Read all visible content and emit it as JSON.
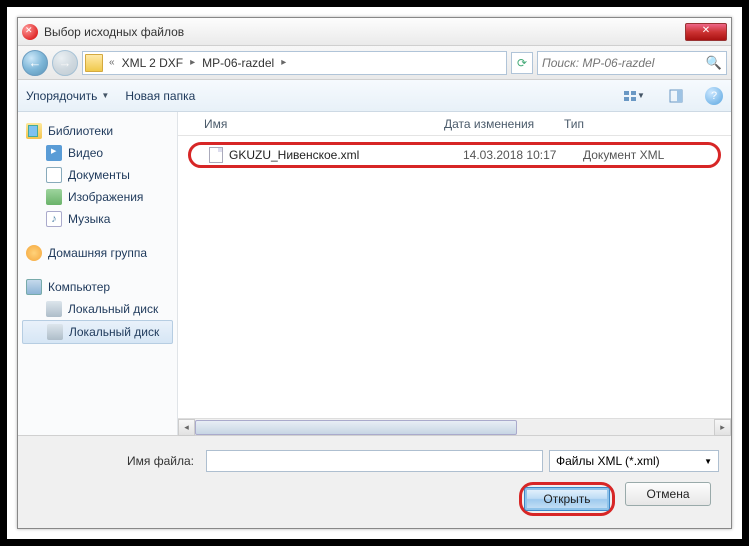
{
  "title": "Выбор исходных файлов",
  "breadcrumb": {
    "p1": "XML 2 DXF",
    "p2": "MP-06-razdel"
  },
  "search": {
    "placeholder": "Поиск: MP-06-razdel"
  },
  "toolbar": {
    "organize": "Упорядочить",
    "newfolder": "Новая папка"
  },
  "tree": {
    "libraries": "Библиотеки",
    "video": "Видео",
    "documents": "Документы",
    "images": "Изображения",
    "music": "Музыка",
    "homegroup": "Домашняя группа",
    "computer": "Компьютер",
    "disk1": "Локальный диск",
    "disk2": "Локальный диск"
  },
  "columns": {
    "name": "Имя",
    "date": "Дата изменения",
    "type": "Тип"
  },
  "file": {
    "name": "GKUZU_Нивенское.xml",
    "date": "14.03.2018 10:17",
    "type": "Документ XML"
  },
  "footer": {
    "fname_label": "Имя файла:",
    "filter": "Файлы XML (*.xml)",
    "open": "Открыть",
    "cancel": "Отмена"
  },
  "music_glyph": "♪"
}
